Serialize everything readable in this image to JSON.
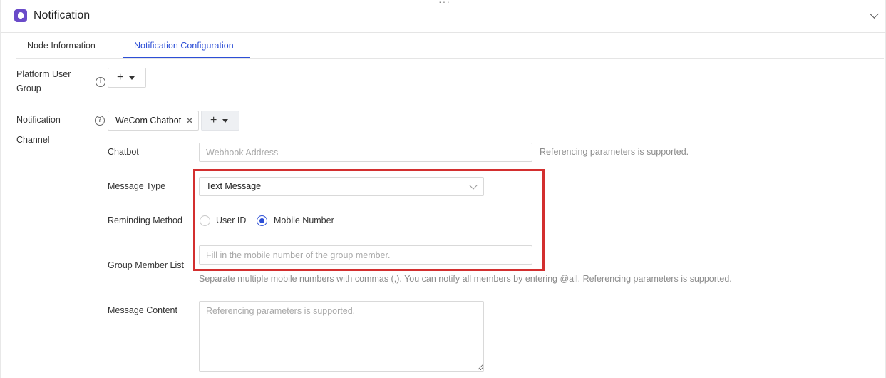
{
  "header": {
    "title": "Notification",
    "icon": "bell-icon",
    "accent": "#6a4bc9",
    "overflow": "···"
  },
  "tabs": [
    {
      "label": "Node Information",
      "active": false
    },
    {
      "label": "Notification Configuration",
      "active": true
    }
  ],
  "colors": {
    "primary": "#2d4fd6",
    "highlight": "#d32f2f"
  },
  "form": {
    "platform_user_group": {
      "label_line1": "Platform User",
      "label_line2": "Group",
      "add_label": "+"
    },
    "notification_channel": {
      "label_line1": "Notification",
      "label_line2": "Channel",
      "chip": "WeCom Chatbot",
      "chip_remove": "✕",
      "add_label": "+"
    },
    "chatbot": {
      "label": "Chatbot",
      "placeholder": "Webhook Address",
      "hint": "Referencing parameters is supported."
    },
    "message_type": {
      "label": "Message Type",
      "value": "Text Message"
    },
    "reminding_method": {
      "label": "Reminding Method",
      "options": [
        {
          "label": "User ID",
          "selected": false
        },
        {
          "label": "Mobile Number",
          "selected": true
        }
      ]
    },
    "group_member_list": {
      "label": "Group Member List",
      "placeholder": "Fill in the mobile number of the group member.",
      "hint": "Separate multiple mobile numbers with commas (,). You can notify all members by entering @all. Referencing parameters is supported."
    },
    "message_content": {
      "label": "Message Content",
      "placeholder": "Referencing parameters is supported."
    }
  }
}
